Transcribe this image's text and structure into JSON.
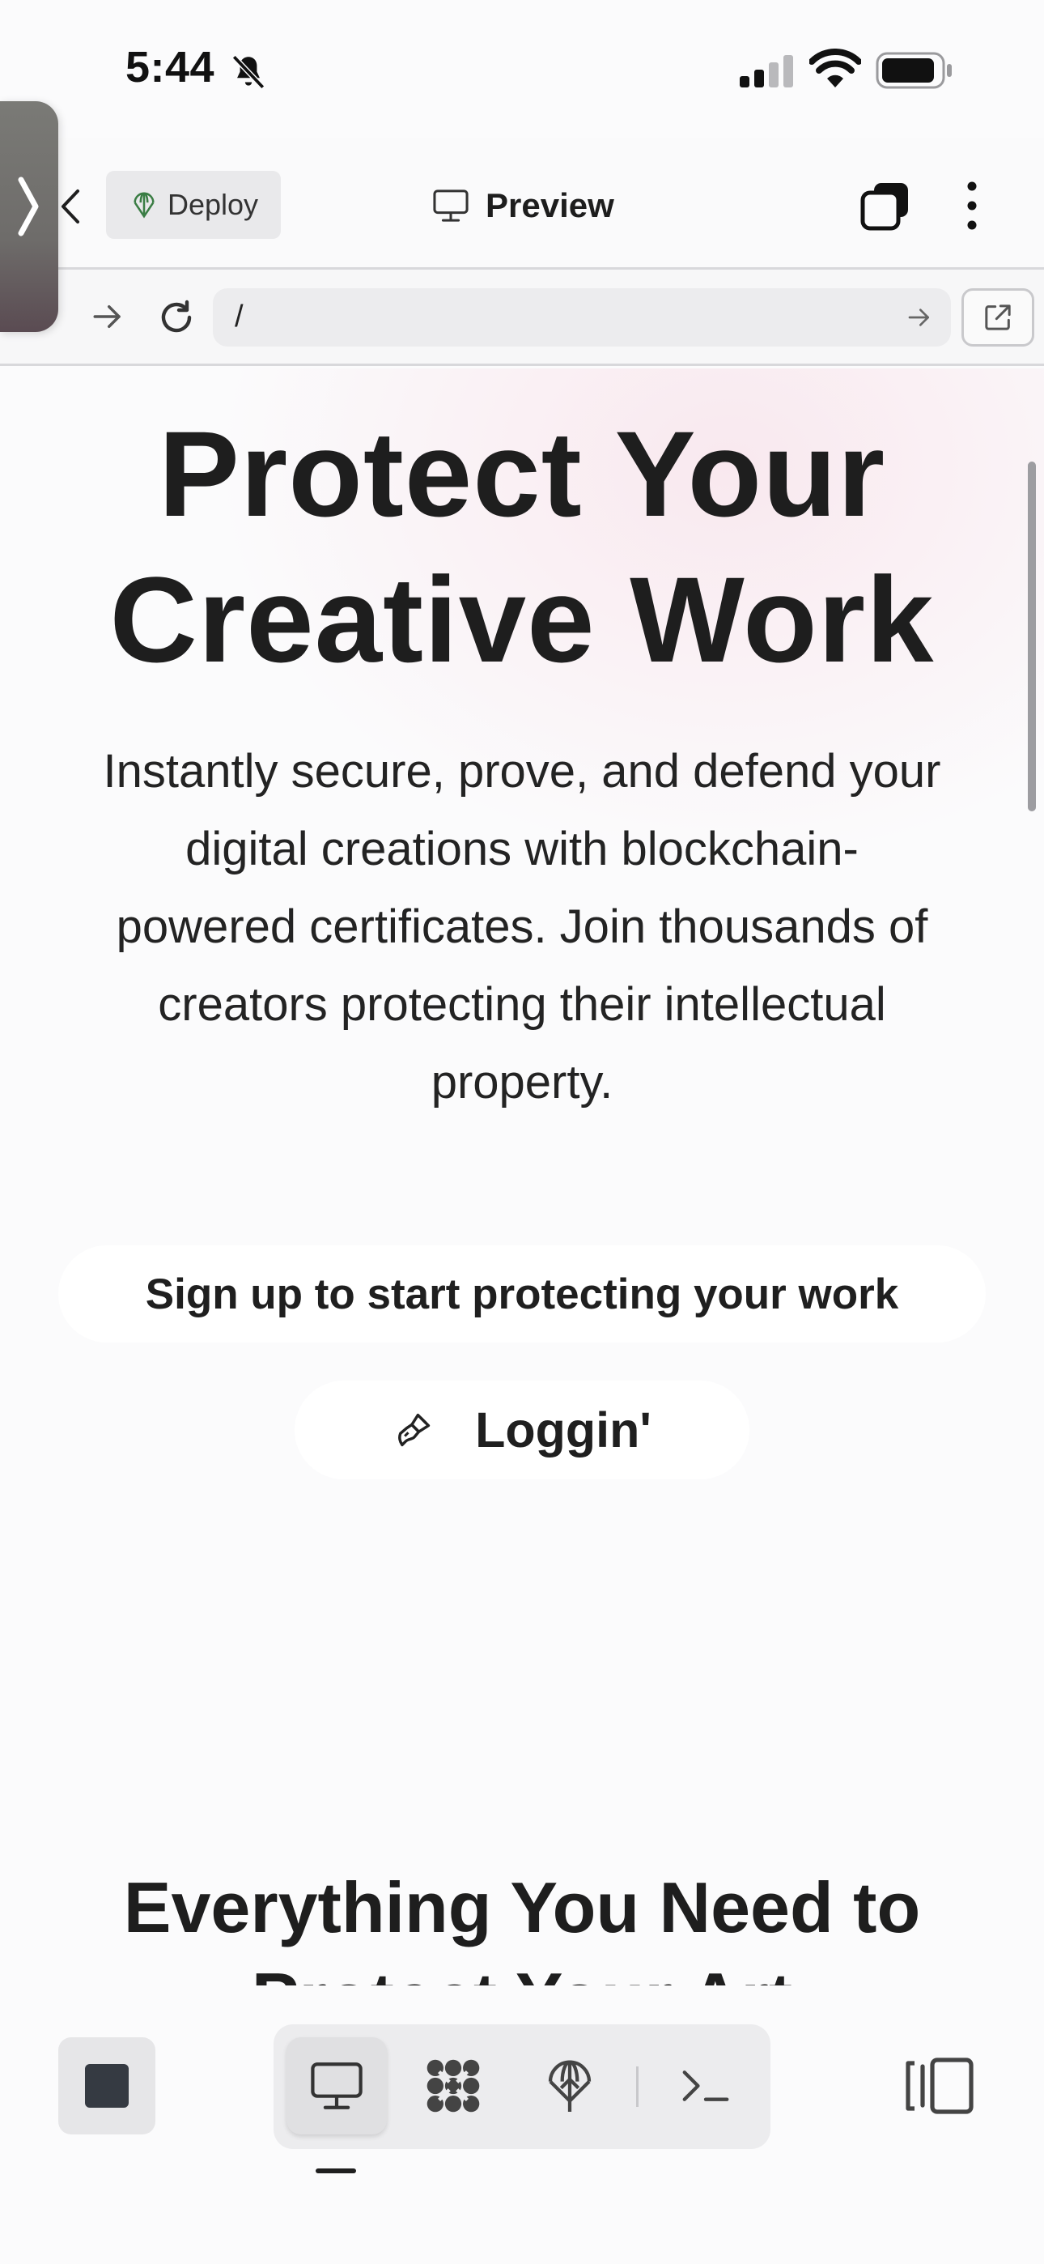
{
  "status_bar": {
    "time": "5:44",
    "icons": [
      "bell-slash-icon",
      "cellular-signal-icon",
      "wifi-icon",
      "battery-icon"
    ]
  },
  "header": {
    "deploy_label": "Deploy",
    "preview_label": "Preview"
  },
  "url_bar": {
    "path": "/"
  },
  "hero": {
    "title_line1": "Protect Your",
    "title_line2": "Creative Work",
    "subtitle_line1": "Instantly secure, prove, and defend your",
    "subtitle_line2": "digital creations with blockchain-",
    "subtitle_line3": "powered certificates. Join thousands of",
    "subtitle_line4": "creators protecting their intellectual",
    "subtitle_line5": "property.",
    "signup_label": "Sign up to start protecting your work",
    "login_label": "Loggin'"
  },
  "features": {
    "title_line1": "Everything You Need to",
    "title_line2": "Protect Your Art"
  },
  "toolbar": {
    "tools": [
      "preview",
      "services",
      "deploy",
      "shell"
    ],
    "active_tool": "preview"
  },
  "colors": {
    "background": "#fbfbfc",
    "text": "#1f1f1f",
    "hero_glow": "#f8e2ea",
    "deploy_icon": "#3a7d44"
  }
}
